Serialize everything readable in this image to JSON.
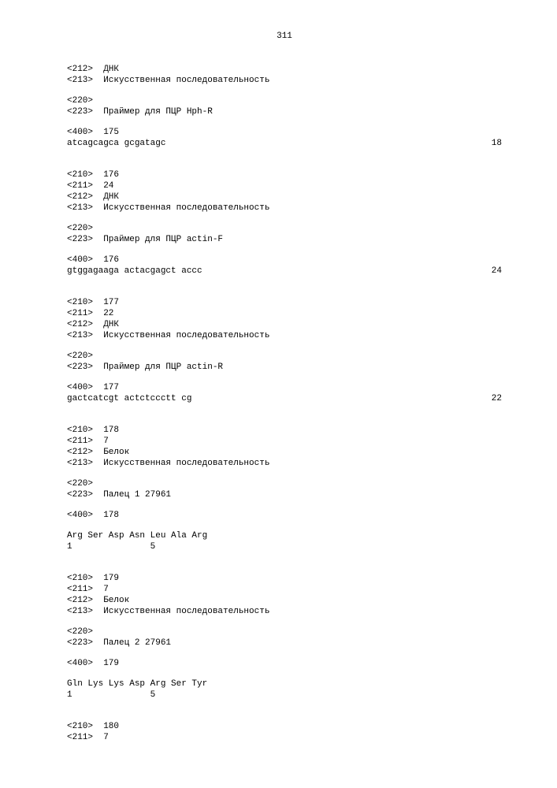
{
  "pageNumber": "311",
  "blocks": [
    {
      "type": "entries",
      "lines": [
        "<212>  ДНК",
        "<213>  Искусственная последовательность"
      ]
    },
    {
      "type": "entries",
      "lines": [
        "<220>",
        "<223>  Праймер для ПЦР Hph-R"
      ]
    },
    {
      "type": "sequence",
      "header": "<400>  175",
      "seq": "atcagcagca gcgatagc",
      "length": "18"
    },
    {
      "type": "entries",
      "lines": [
        "<210>  176",
        "<211>  24",
        "<212>  ДНК",
        "<213>  Искусственная последовательность"
      ]
    },
    {
      "type": "entries",
      "lines": [
        "<220>",
        "<223>  Праймер для ПЦР actin-F"
      ]
    },
    {
      "type": "sequence",
      "header": "<400>  176",
      "seq": "gtggagaaga actacgagct accc",
      "length": "24"
    },
    {
      "type": "entries",
      "lines": [
        "<210>  177",
        "<211>  22",
        "<212>  ДНК",
        "<213>  Искусственная последовательность"
      ]
    },
    {
      "type": "entries",
      "lines": [
        "<220>",
        "<223>  Праймер для ПЦР actin-R"
      ]
    },
    {
      "type": "sequence",
      "header": "<400>  177",
      "seq": "gactcatcgt actctccctt cg",
      "length": "22"
    },
    {
      "type": "entries",
      "lines": [
        "<210>  178",
        "<211>  7",
        "<212>  Белок",
        "<213>  Искусственная последовательность"
      ]
    },
    {
      "type": "entries",
      "lines": [
        "<220>",
        "<223>  Палец 1 27961"
      ]
    },
    {
      "type": "protein",
      "header": "<400>  178",
      "seqLine": "Arg Ser Asp Asn Leu Ala Arg",
      "numLine": "1               5"
    },
    {
      "type": "entries",
      "lines": [
        "<210>  179",
        "<211>  7",
        "<212>  Белок",
        "<213>  Искусственная последовательность"
      ]
    },
    {
      "type": "entries",
      "lines": [
        "<220>",
        "<223>  Палец 2 27961"
      ]
    },
    {
      "type": "protein",
      "header": "<400>  179",
      "seqLine": "Gln Lys Lys Asp Arg Ser Tyr",
      "numLine": "1               5"
    },
    {
      "type": "entries",
      "lines": [
        "<210>  180",
        "<211>  7"
      ]
    }
  ]
}
